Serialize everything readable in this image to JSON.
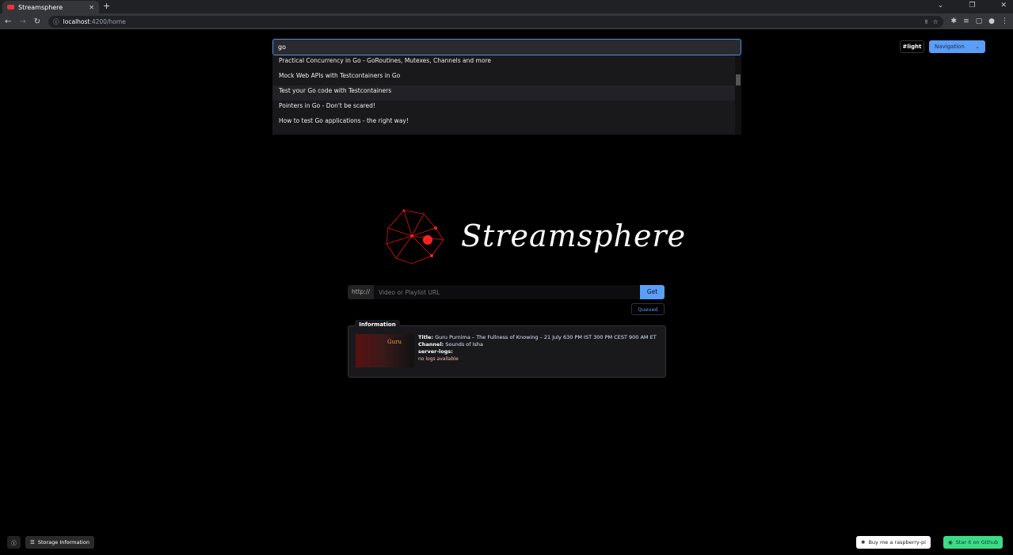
{
  "browser": {
    "tab_title": "Streamsphere",
    "url_host": "localhost",
    "url_path": ":4200/home"
  },
  "search": {
    "value": "go",
    "results": [
      "Practical Concurrency in Go - GoRoutines, Mutexes, Channels and more",
      "Mock Web APIs with Testcontainers in Go",
      "Test your Go code with Testcontainers",
      "Pointers in Go - Don't be scared!",
      "How to test Go applications - the right way!"
    ]
  },
  "header": {
    "theme_label": "#light",
    "nav_label": "Navigation"
  },
  "logo": {
    "text": "Streamsphere"
  },
  "url_input": {
    "prefix": "http://",
    "placeholder": "Video or Playlist URL",
    "button": "Get"
  },
  "queued_label": "Queued",
  "info": {
    "tab_label": "Information",
    "thumb_text": "Guru",
    "title_label": "Title:",
    "title": "Guru Purnima – The Fullness of Knowing – 21 July 630 PM IST 300 PM CEST 900 AM ET",
    "channel_label": "Channel:",
    "channel": "Sounds of Isha",
    "logs_label": "server-logs:",
    "logs": "no logs available"
  },
  "footer": {
    "info_icon": "ⓘ",
    "storage": "Storage Information",
    "donate": "Buy me a raspberry-pi",
    "github": "Star it on Github"
  },
  "colors": {
    "accent": "#5a9ef8",
    "github": "#3ddc84"
  }
}
